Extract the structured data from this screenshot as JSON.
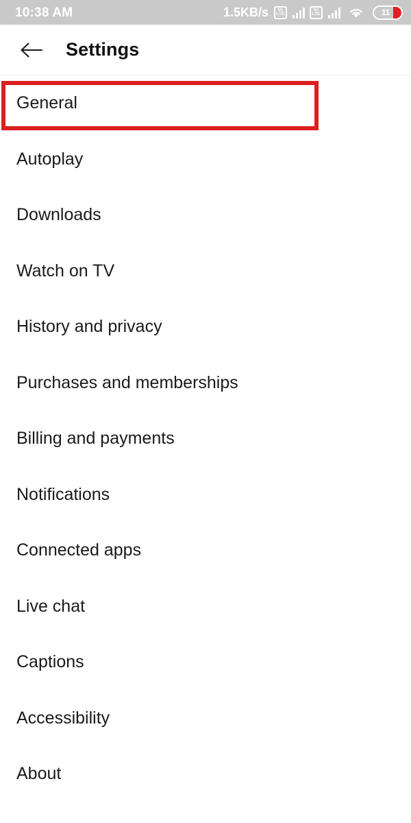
{
  "status_bar": {
    "time": "10:38 AM",
    "network_speed": "1.5KB/s",
    "volte_label_top": "Vo",
    "volte_label_bottom": "LTE",
    "sim1_icon": "volte-icon",
    "sim1_signal_icon": "signal-bars-icon",
    "sim2_icon": "volte-icon",
    "sim2_signal_icon": "signal-bars-icon",
    "wifi_icon": "wifi-icon",
    "battery_percent": "11",
    "battery_icon": "battery-icon",
    "background_color": "#c9c9c9",
    "text_color": "#ffffff"
  },
  "app_bar": {
    "back_icon": "arrow-left-icon",
    "title": "Settings"
  },
  "settings": {
    "items": [
      {
        "label": "General"
      },
      {
        "label": "Autoplay"
      },
      {
        "label": "Downloads"
      },
      {
        "label": "Watch on TV"
      },
      {
        "label": "History and privacy"
      },
      {
        "label": "Purchases and memberships"
      },
      {
        "label": "Billing and payments"
      },
      {
        "label": "Notifications"
      },
      {
        "label": "Connected apps"
      },
      {
        "label": "Live chat"
      },
      {
        "label": "Captions"
      },
      {
        "label": "Accessibility"
      },
      {
        "label": "About"
      }
    ]
  },
  "annotation": {
    "highlight_target": "General",
    "highlight_color": "#dd1f1f"
  }
}
